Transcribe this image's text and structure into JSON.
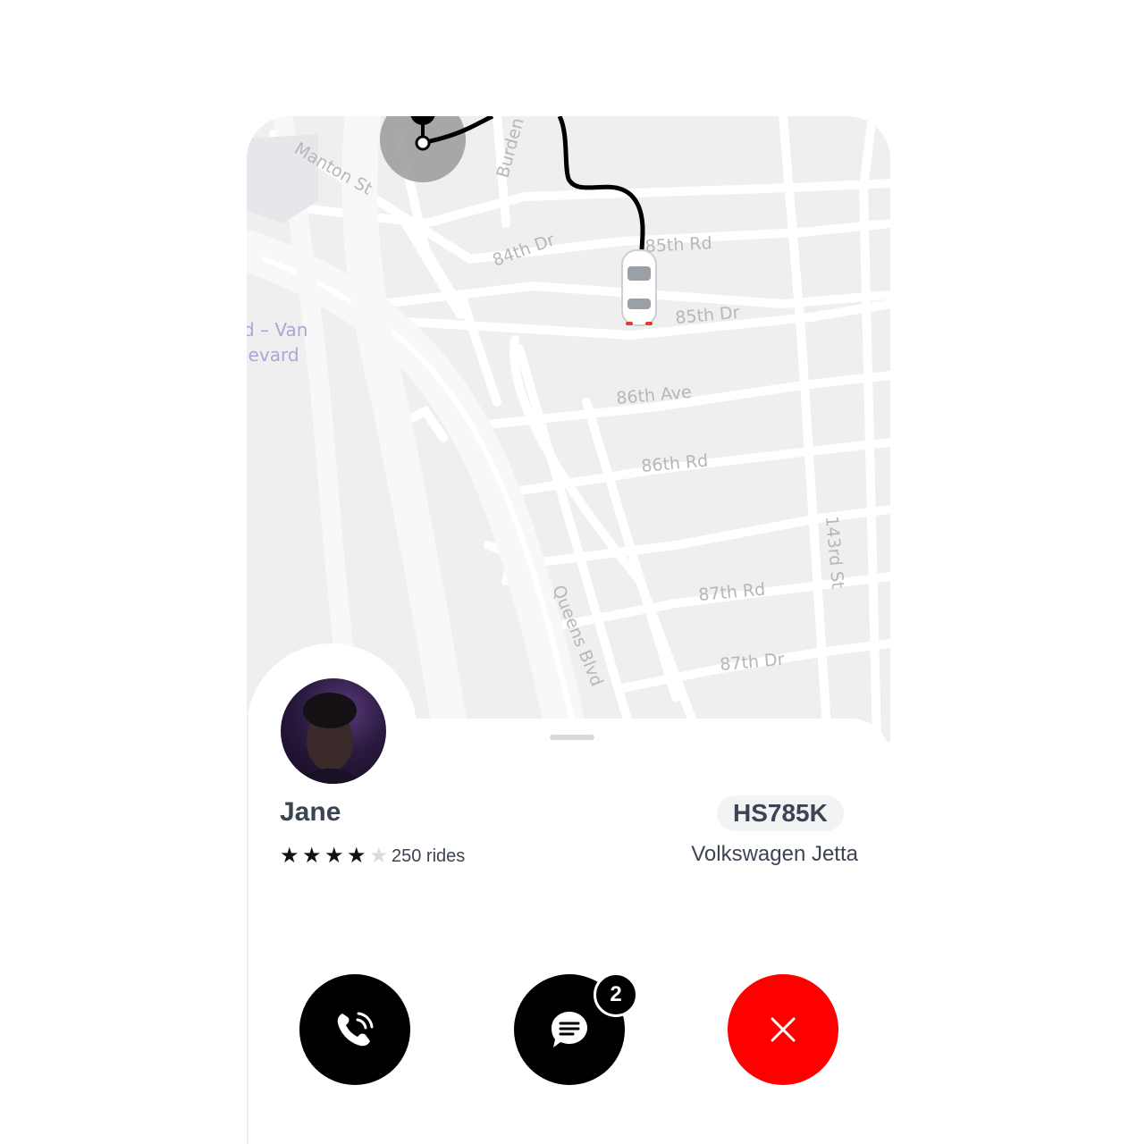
{
  "map": {
    "streets": [
      "Manton St",
      "Burden",
      "84th Dr",
      "85th Rd",
      "85th Dr",
      "86th Ave",
      "86th Rd",
      "143rd St",
      "Queens Blvd",
      "87th Rd",
      "87th Dr"
    ],
    "poi_label_line1": "d – Van",
    "poi_label_line2": "levard"
  },
  "driver": {
    "name": "Jane",
    "rating": 4,
    "rating_max": 5,
    "rides": "250 rides"
  },
  "vehicle": {
    "plate": "HS785K",
    "model": "Volkswagen Jetta"
  },
  "actions": {
    "call_icon": "phone-icon",
    "chat_icon": "chat-bubble-icon",
    "chat_badge": "2",
    "cancel_icon": "close-icon"
  },
  "colors": {
    "cancel": "#ff0000",
    "action_dark": "#000000",
    "text": "#3c4454"
  }
}
